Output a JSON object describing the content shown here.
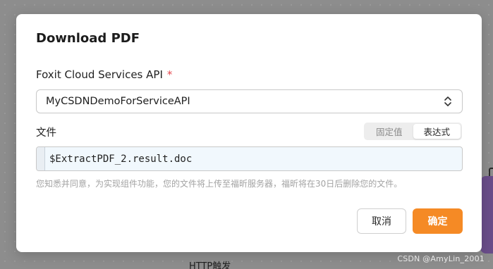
{
  "background": {
    "partial_label": "HTTP触发",
    "watermark": "CSDN @AmyLin_2001"
  },
  "dialog": {
    "title": "Download PDF",
    "api_field": {
      "label": "Foxit Cloud Services API",
      "required_marker": "*",
      "selected_value": "MyCSDNDemoForServiceAPI"
    },
    "file_field": {
      "label": "文件",
      "mode_toggle": [
        "固定值",
        "表达式"
      ],
      "active_mode": "表达式",
      "value": "$ExtractPDF_2.result.doc"
    },
    "notice": "您知悉并同意，为实现组件功能，您的文件将上传至福昕服务器，福昕将在30日后删除您的文件。",
    "buttons": {
      "cancel": "取消",
      "confirm": "确定"
    }
  },
  "colors": {
    "accent": "#f58a25",
    "required": "#e5484d",
    "overlay": "#8a8a8a",
    "input_bg": "#f1f8fd"
  }
}
